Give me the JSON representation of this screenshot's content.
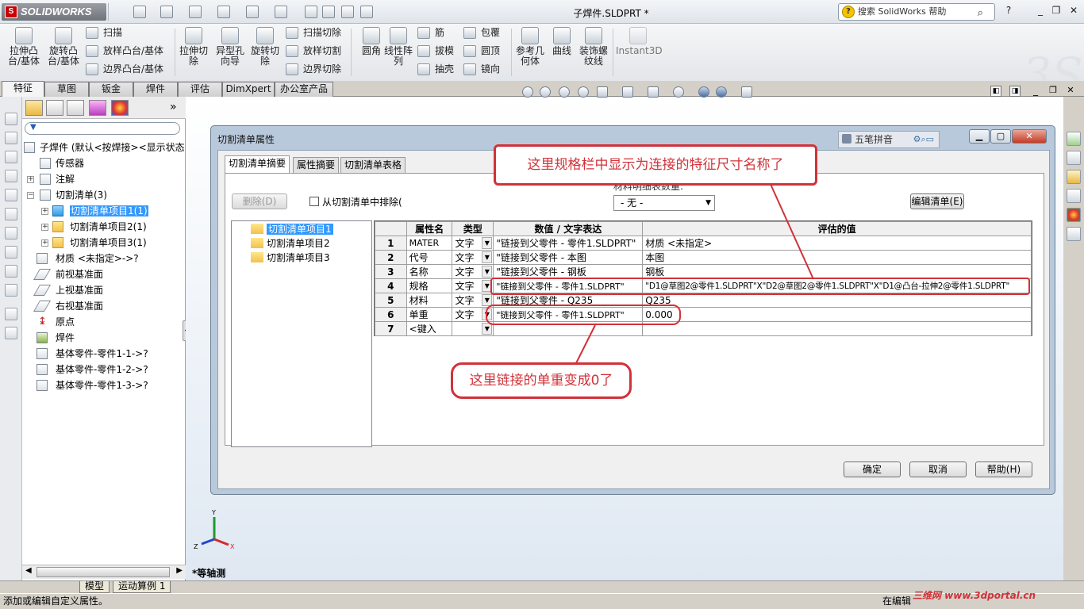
{
  "app": {
    "logo_text": "SOLIDWORKS",
    "doc_title": "子焊件.SLDPRT *",
    "help_search": "搜索 SolidWorks 帮助"
  },
  "ribbon": {
    "big_tools": [
      "拉伸凸\n台/基体",
      "旋转凸\n台/基体",
      "拉伸切\n除",
      "异型孔\n向导",
      "旋转切\n除",
      "圆角",
      "线性阵\n列",
      "参考几\n何体",
      "曲线",
      "装饰螺\n纹线",
      "Instant3D"
    ],
    "small_group1": [
      "扫描",
      "放样凸台/基体",
      "边界凸台/基体"
    ],
    "small_group2": [
      "扫描切除",
      "放样切割",
      "边界切除"
    ],
    "small_group3": [
      "筋",
      "拔模",
      "抽壳"
    ],
    "small_group4": [
      "包覆",
      "圆顶",
      "镜向"
    ]
  },
  "tabs": [
    "特征",
    "草图",
    "钣金",
    "焊件",
    "评估",
    "DimXpert",
    "办公室产品"
  ],
  "feature_tree": {
    "root": "子焊件 (默认<按焊接><显示状态",
    "items": [
      "传感器",
      "注解",
      "切割清单(3)",
      "切割清单项目1(1)",
      "切割清单项目2(1)",
      "切割清单项目3(1)",
      "材质 <未指定>->?",
      "前视基准面",
      "上视基准面",
      "右视基准面",
      "原点",
      "焊件",
      "基体零件-零件1-1->?",
      "基体零件-零件1-2->?",
      "基体零件-零件1-3->?"
    ]
  },
  "bottom_tabs": [
    "模型",
    "运动算例 1"
  ],
  "status": {
    "left": "添加或编辑自定义属性。",
    "right": "在编辑"
  },
  "view": {
    "name": "*等轴测",
    "axes": [
      "Y",
      "X",
      "Z"
    ]
  },
  "dialog": {
    "title": "切割清单属性",
    "ime": "五笔拼音",
    "tabs": [
      "切割清单摘要",
      "属性摘要",
      "切割清单表格"
    ],
    "delete_btn": "删除(D)",
    "exclude_label": "从切割清单中排除(",
    "material_table_label": "材料明细表数量:",
    "combo_value": "- 无 -",
    "edit_list_btn": "编辑清单(E)",
    "tree": [
      "切割清单项目1",
      "切割清单项目2",
      "切割清单项目3"
    ],
    "columns": [
      "",
      "属性名",
      "类型",
      "数值 / 文字表达",
      "评估的值"
    ],
    "rows": [
      [
        "1",
        "MATER",
        "文字",
        "\"链接到父零件 - 零件1.SLDPRT\"",
        "材质 <未指定>"
      ],
      [
        "2",
        "代号",
        "文字",
        "\"链接到父零件 - 本图",
        "本图"
      ],
      [
        "3",
        "名称",
        "文字",
        "\"链接到父零件 - 钢板",
        "钢板"
      ],
      [
        "4",
        "规格",
        "文字",
        "\"链接到父零件 - 零件1.SLDPRT\"",
        "\"D1@草图2@零件1.SLDPRT\"X\"D2@草图2@零件1.SLDPRT\"X\"D1@凸台-拉伸2@零件1.SLDPRT\""
      ],
      [
        "5",
        "材料",
        "文字",
        "\"链接到父零件 - Q235",
        "Q235"
      ],
      [
        "6",
        "单重",
        "文字",
        "\"链接到父零件 - 零件1.SLDPRT\"",
        "0.000"
      ],
      [
        "7",
        "<键入",
        "",
        "",
        ""
      ]
    ],
    "ok": "确定",
    "cancel": "取消",
    "help": "帮助(H)"
  },
  "annotations": {
    "top": "这里规格栏中显示为连接的特征尺寸名称了",
    "bottom": "这里链接的单重变成0了"
  },
  "watermark": "三维网 www.3dportal.cn",
  "colors": {
    "annotation": "#d13239",
    "selection": "#3399ff"
  }
}
